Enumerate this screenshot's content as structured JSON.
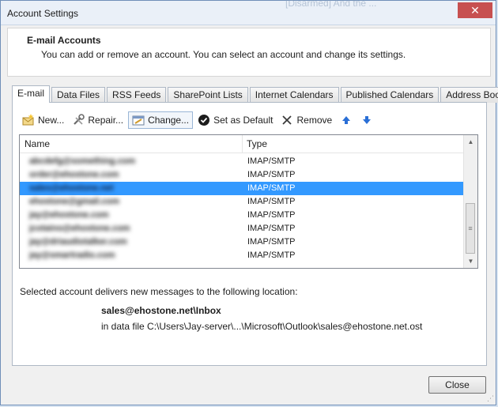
{
  "window": {
    "title": "Account Settings",
    "background_text": "[Disarmed] And the ..."
  },
  "header": {
    "heading": "E-mail Accounts",
    "description": "You can add or remove an account. You can select an account and change its settings."
  },
  "tabs": [
    {
      "label": "E-mail",
      "active": true
    },
    {
      "label": "Data Files"
    },
    {
      "label": "RSS Feeds"
    },
    {
      "label": "SharePoint Lists"
    },
    {
      "label": "Internet Calendars"
    },
    {
      "label": "Published Calendars"
    },
    {
      "label": "Address Books"
    }
  ],
  "toolbar": {
    "new_label": "New...",
    "repair_label": "Repair...",
    "change_label": "Change...",
    "set_default_label": "Set as Default",
    "remove_label": "Remove"
  },
  "list": {
    "columns": [
      "Name",
      "Type"
    ],
    "rows": [
      {
        "name": "abcdefg@something.com",
        "type": "IMAP/SMTP"
      },
      {
        "name": "order@ehostone.com",
        "type": "IMAP/SMTP"
      },
      {
        "name": "sales@ehostone.net",
        "type": "IMAP/SMTP",
        "selected": true
      },
      {
        "name": "ehostone@gmail.com",
        "type": "IMAP/SMTP"
      },
      {
        "name": "jay@ehostone.com",
        "type": "IMAP/SMTP"
      },
      {
        "name": "jcotaino@ehostone.com",
        "type": "IMAP/SMTP"
      },
      {
        "name": "jay@driaudiotalker.com",
        "type": "IMAP/SMTP"
      },
      {
        "name": "jay@smartradio.com",
        "type": "IMAP/SMTP"
      }
    ]
  },
  "delivery": {
    "label": "Selected account delivers new messages to the following location:",
    "inbox": "sales@ehostone.net\\Inbox",
    "data_file": "in data file C:\\Users\\Jay-server\\...\\Microsoft\\Outlook\\sales@ehostone.net.ost"
  },
  "footer": {
    "close_label": "Close"
  },
  "colors": {
    "selection": "#3399ff",
    "arrow_blue": "#2a6fd6",
    "check_dark": "#1c1c1c"
  }
}
